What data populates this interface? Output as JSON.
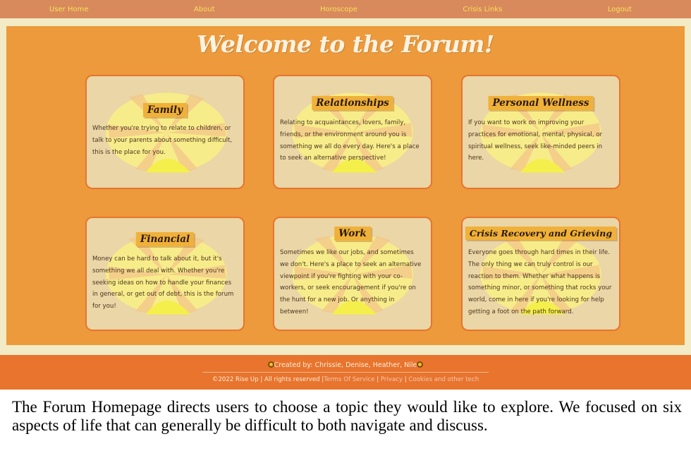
{
  "nav": {
    "items": [
      "User Home",
      "About",
      "Horoscope",
      "Crisis Links",
      "Logout"
    ]
  },
  "page": {
    "title": "Welcome to the Forum!"
  },
  "cards": [
    {
      "title": "Family",
      "text": "Whether you're trying to relate to children, or talk to your parents about something difficult, this is the place for you."
    },
    {
      "title": "Relationships",
      "text": "Relating to acquaintances, lovers, family, friends, or the environment around you is something we all do every day. Here's a place to seek an alternative perspective!"
    },
    {
      "title": "Personal Wellness",
      "text": "If you want to work on improving your practices for emotional, mental, physical, or spiritual wellness, seek like-minded peers in here."
    },
    {
      "title": "Financial",
      "text": "Money can be hard to talk about it, but it's something we all deal with. Whether you're seeking ideas on how to handle your finances in general, or get out of debt, this is the forum for you!"
    },
    {
      "title": "Work",
      "text": "Sometimes we like our jobs, and sometimes we don't. Here's a place to seek an alternative viewpoint if you're fighting with your co-workers, or seek encouragement if you're on the hunt for a new job. Or anything in between!"
    },
    {
      "title": "Crisis Recovery and Grieving",
      "text": "Everyone goes through hard times in their life. The only thing we can truly control is our reaction to them. Whether what happens is something minor, or something that rocks your world, come in here if you're looking for help getting a foot on the path forward."
    }
  ],
  "footer": {
    "credit": "Created by: Chrissie, Denise, Heather, Nile",
    "copyright": "©2022 Rise Up | All rights reserved",
    "sep": "|",
    "links": [
      "Terms Of Service",
      "Privacy",
      "Cookies and other tech"
    ]
  },
  "caption": "The Forum Homepage directs users to choose a topic they would like to explore. We focused on six aspects of life that can generally be difficult to both navigate and discuss.",
  "colors": {
    "nav_bg": "#d98a5c",
    "nav_text": "#f6e05a",
    "page_bg": "#f2ebc6",
    "main_bg": "#ec9a3c",
    "card_bg": "#ead6a6",
    "card_border": "#e8742e",
    "title_tag": "#f0b13a",
    "footer_bg": "#e8742e"
  }
}
